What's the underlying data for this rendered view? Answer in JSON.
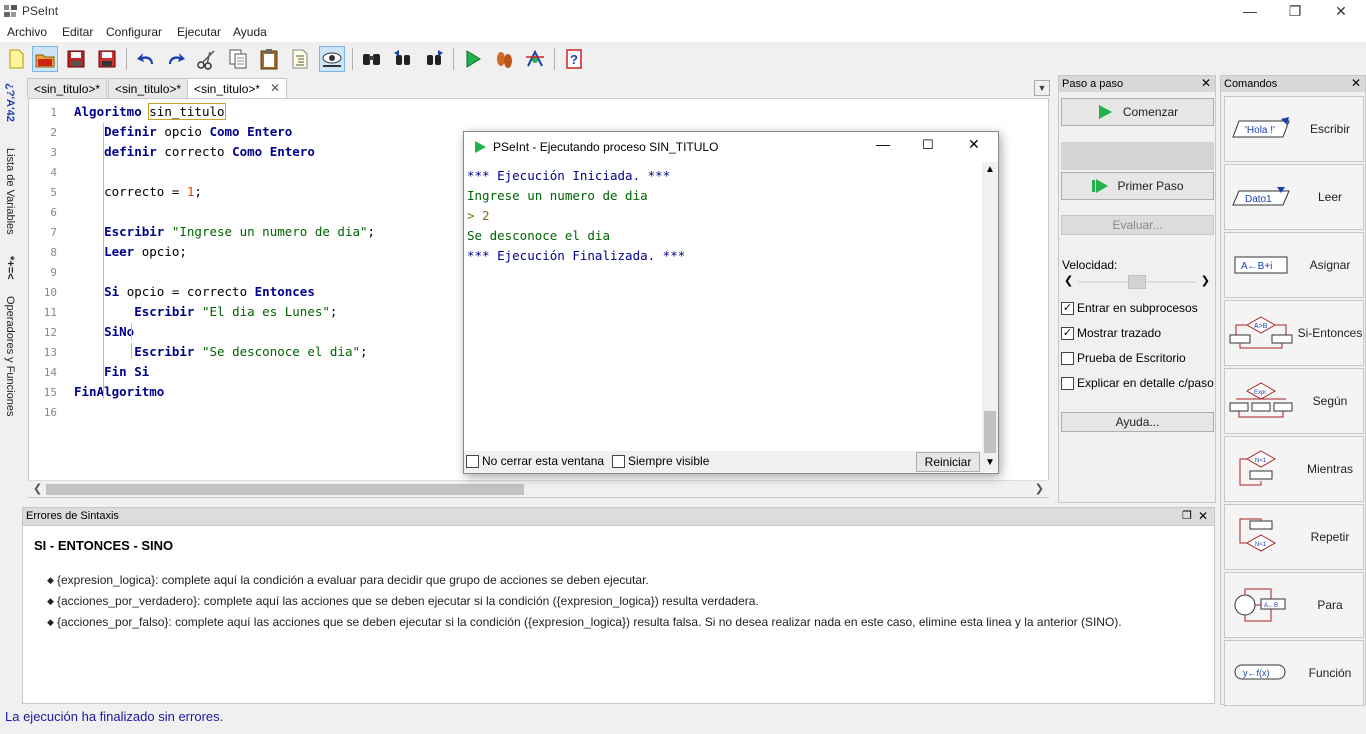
{
  "window": {
    "title": "PSeInt"
  },
  "menu": [
    "Archivo",
    "Editar",
    "Configurar",
    "Ejecutar",
    "Ayuda"
  ],
  "toolbar": [
    "new-file",
    "open-file",
    "save",
    "save-as",
    "undo",
    "redo",
    "cut",
    "copy",
    "paste",
    "edit-indent",
    "inspect",
    "find",
    "find-previous",
    "find-next",
    "run",
    "step",
    "debug",
    "help"
  ],
  "left_tabs": {
    "variables": "Lista de Variables",
    "operators": "Operadores y Funciones",
    "vars_icon": "*+=<",
    "ops_icon": "¿?'A'42"
  },
  "tabs": [
    "<sin_titulo>*",
    "<sin_titulo>*",
    "<sin_titulo>*"
  ],
  "editor": {
    "line_numbers": [
      "1",
      "2",
      "3",
      "4",
      "5",
      "6",
      "7",
      "8",
      "9",
      "10",
      "11",
      "12",
      "13",
      "14",
      "15",
      "16"
    ],
    "lines": [
      [
        [
          "kw",
          "Algoritmo "
        ],
        [
          "box",
          "sin_titulo"
        ]
      ],
      [
        [
          "t",
          "    "
        ],
        [
          "kw",
          "Definir"
        ],
        [
          "t",
          " opcio "
        ],
        [
          "kw",
          "Como Entero"
        ]
      ],
      [
        [
          "t",
          "    "
        ],
        [
          "kw",
          "definir"
        ],
        [
          "t",
          " correcto "
        ],
        [
          "kw",
          "Como Entero"
        ]
      ],
      [],
      [
        [
          "t",
          "    correcto = "
        ],
        [
          "num",
          "1"
        ],
        [
          "t",
          ";"
        ]
      ],
      [],
      [
        [
          "t",
          "    "
        ],
        [
          "kw",
          "Escribir"
        ],
        [
          "t",
          " "
        ],
        [
          "str",
          "\"Ingrese un numero de dia\""
        ],
        [
          "t",
          ";"
        ]
      ],
      [
        [
          "t",
          "    "
        ],
        [
          "kw",
          "Leer"
        ],
        [
          "t",
          " opcio;"
        ]
      ],
      [],
      [
        [
          "t",
          "    "
        ],
        [
          "kw",
          "Si"
        ],
        [
          "t",
          " opcio = correcto "
        ],
        [
          "kw",
          "Entonces"
        ]
      ],
      [
        [
          "t",
          "        "
        ],
        [
          "kw",
          "Escribir"
        ],
        [
          "t",
          " "
        ],
        [
          "str",
          "\"El dia es Lunes\""
        ],
        [
          "t",
          ";"
        ]
      ],
      [
        [
          "t",
          "    "
        ],
        [
          "kw",
          "SiNo"
        ]
      ],
      [
        [
          "t",
          "        "
        ],
        [
          "kw",
          "Escribir"
        ],
        [
          "t",
          " "
        ],
        [
          "str",
          "\"Se desconoce el dia\""
        ],
        [
          "t",
          ";"
        ]
      ],
      [
        [
          "t",
          "    "
        ],
        [
          "kw",
          "Fin Si"
        ]
      ],
      [
        [
          "kw",
          "FinAlgoritmo"
        ]
      ],
      []
    ]
  },
  "errors": {
    "header": "Errores de Sintaxis",
    "title": "SI - ENTONCES - SINO",
    "bullets": [
      "{expresion_logica}: complete aquí la condición a evaluar para decidir que grupo de acciones se deben ejecutar.",
      "{acciones_por_verdadero}: complete aquí las acciones que se deben ejecutar si la condición ({expresion_logica}) resulta verdadera.",
      "{acciones_por_falso}: complete aquí las acciones que se deben ejecutar si la condición ({expresion_logica}) resulta falsa. Si no desea realizar nada en este caso, elimine esta linea y la anterior (SINO)."
    ]
  },
  "status": "La ejecución ha finalizado sin errores.",
  "paso": {
    "header": "Paso a paso",
    "comenzar": "Comenzar",
    "primer_paso": "Primer Paso",
    "evaluar": "Evaluar...",
    "velocidad": "Velocidad:",
    "speed_level": 0.5,
    "checks": [
      {
        "label": "Entrar en subprocesos",
        "checked": true
      },
      {
        "label": "Mostrar trazado",
        "checked": true
      },
      {
        "label": "Prueba de Escritorio",
        "checked": false
      },
      {
        "label": "Explicar en detalle c/paso",
        "checked": false
      }
    ],
    "ayuda": "Ayuda..."
  },
  "comandos": {
    "header": "Comandos",
    "items": [
      {
        "label": "Escribir",
        "icon_text": "'Hola !'"
      },
      {
        "label": "Leer",
        "icon_text": "Dato1"
      },
      {
        "label": "Asignar",
        "icon_text": "A←B+i"
      },
      {
        "label": "Si-Entonces",
        "icon_text": "A>B"
      },
      {
        "label": "Según",
        "icon_text": "Expr"
      },
      {
        "label": "Mientras",
        "icon_text": "N<1"
      },
      {
        "label": "Repetir",
        "icon_text": "N<1"
      },
      {
        "label": "Para",
        "icon_text": "A←B"
      },
      {
        "label": "Función",
        "icon_text": "y←f(x)"
      }
    ]
  },
  "dialog": {
    "title": "PSeInt - Ejecutando proceso SIN_TITULO",
    "lines": [
      {
        "text": "*** Ejecución Iniciada. ***",
        "color": "#00008b"
      },
      {
        "text": "Ingrese un numero de dia",
        "color": "#006400"
      },
      {
        "text": "> 2",
        "color": "#8b6914"
      },
      {
        "text": "Se desconoce el dia",
        "color": "#006400"
      },
      {
        "text": "*** Ejecución Finalizada. ***",
        "color": "#00008b"
      }
    ],
    "no_cerrar": "No cerrar esta ventana",
    "siempre_visible": "Siempre visible",
    "reiniciar": "Reiniciar"
  },
  "colors": {
    "accent_green": "#22b14c",
    "keyword": "#00008b",
    "string": "#006400"
  }
}
